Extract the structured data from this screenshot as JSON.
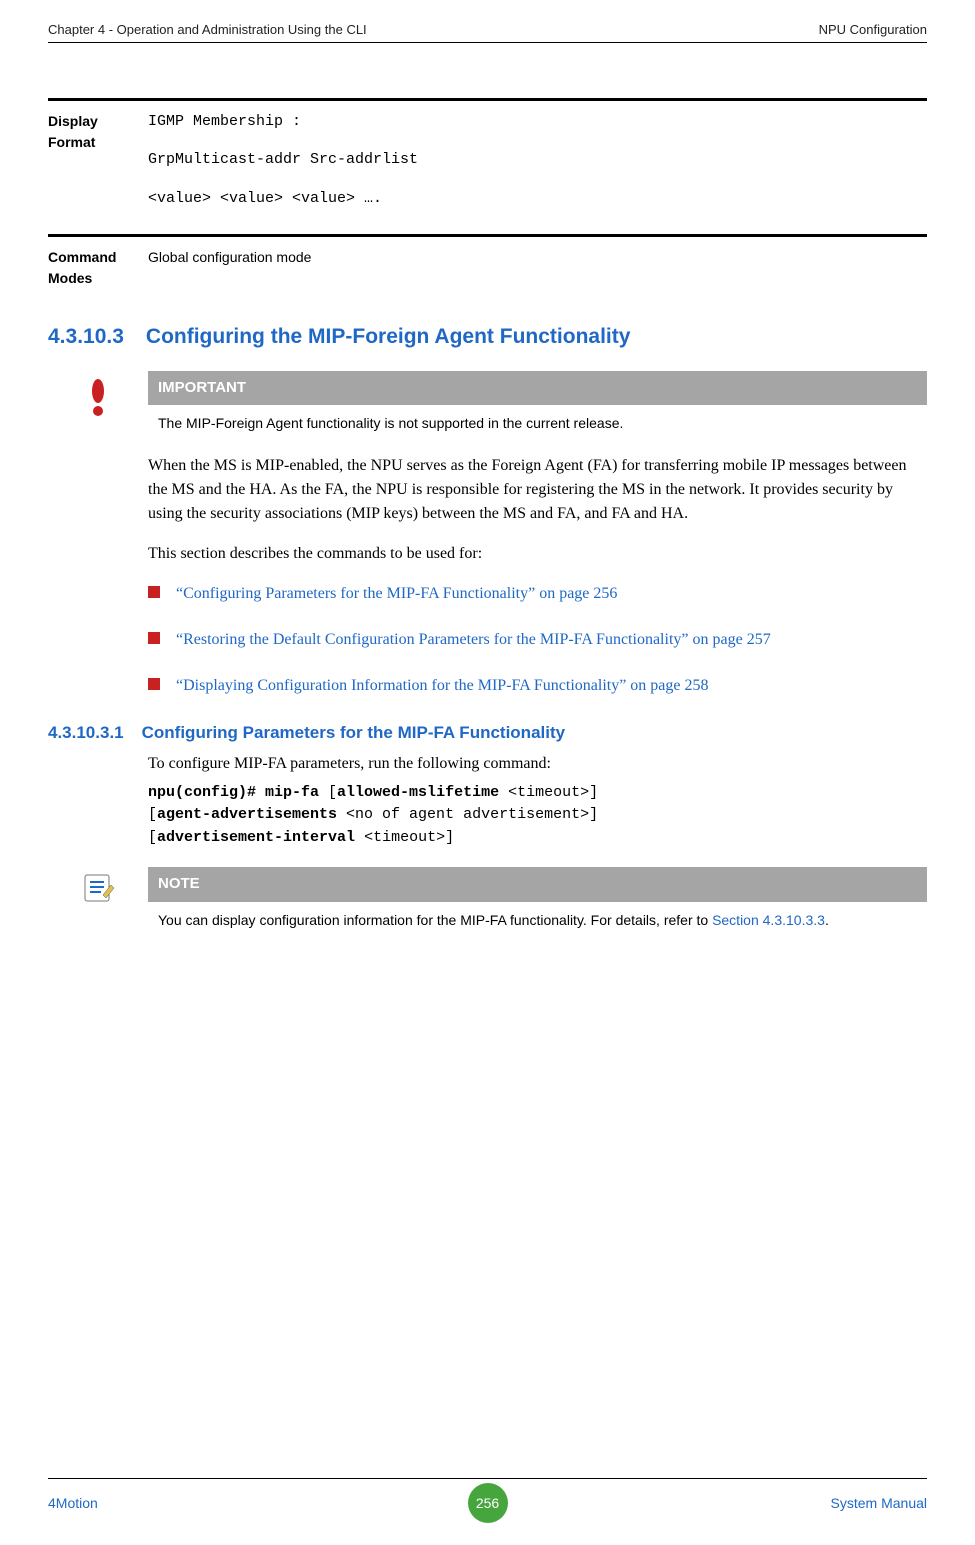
{
  "header": {
    "left": "Chapter 4 - Operation and Administration Using the CLI",
    "right": "NPU Configuration"
  },
  "displayFormat": {
    "label": "Display Format",
    "line1": "IGMP Membership :",
    "line2": "GrpMulticast-addr   Src-addrlist",
    "line3": "<value>        <value> <value> …."
  },
  "commandModes": {
    "label": "Command Modes",
    "value": "Global configuration mode"
  },
  "section4_3_10_3": {
    "num": "4.3.10.3",
    "title": "Configuring the MIP-Foreign Agent Functionality"
  },
  "important": {
    "heading": "IMPORTANT",
    "body": "The MIP-Foreign Agent functionality is not supported in the current release."
  },
  "para1": "When the MS is MIP-enabled, the NPU serves as the Foreign Agent (FA) for transferring mobile IP messages between the MS and the HA. As the FA, the NPU is responsible for registering the MS in the network. It provides security by using the security associations (MIP keys) between the MS and FA, and FA and HA.",
  "para2": "This section describes the commands to be used for:",
  "bullets": [
    "“Configuring Parameters for the MIP-FA Functionality” on page 256",
    "“Restoring the Default Configuration Parameters for the MIP-FA Functionality” on page 257",
    "“Displaying Configuration Information for the MIP-FA Functionality” on page 258"
  ],
  "section4_3_10_3_1": {
    "num": "4.3.10.3.1",
    "title": "Configuring Parameters for the MIP-FA Functionality"
  },
  "para3": "To configure MIP-FA parameters, run the following command:",
  "command": {
    "s1": "npu(config)# mip-fa ",
    "s2": "[",
    "s3": "allowed-mslifetime ",
    "s4": "<timeout>] ",
    "s5": "[",
    "s6": "agent-advertisements ",
    "s7": "<no of agent advertisement>] ",
    "s8": "[",
    "s9": "advertisement-interval ",
    "s10": "<timeout>]"
  },
  "note": {
    "heading": "NOTE",
    "bodyPrefix": "You can display configuration information for the MIP-FA functionality. For details, refer to ",
    "link": "Section 4.3.10.3.3",
    "suffix": "."
  },
  "footer": {
    "left": "4Motion",
    "page": "256",
    "right": "System Manual"
  }
}
